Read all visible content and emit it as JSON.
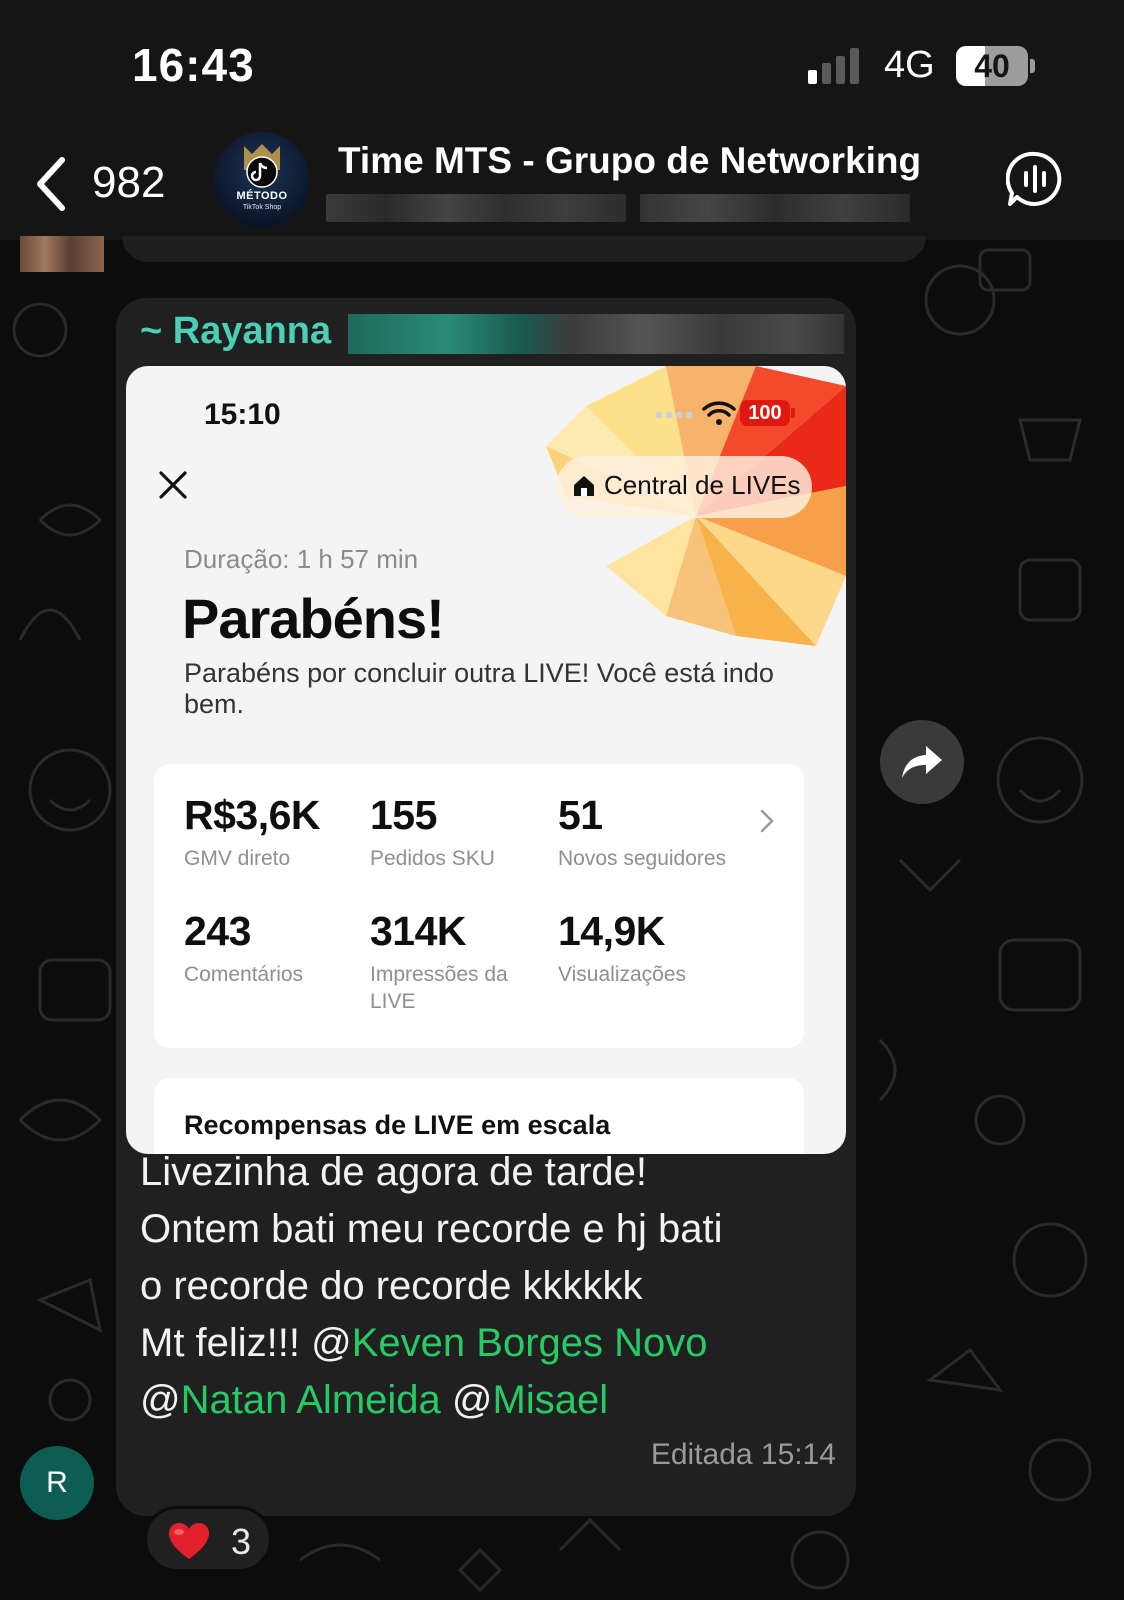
{
  "status_bar": {
    "time": "16:43",
    "network": "4G",
    "battery_level": 40,
    "battery_label": "40"
  },
  "chat_header": {
    "back_count": "982",
    "group_name": "Time MTS - Grupo de Networking",
    "avatar_text_line1": "MÉTODO",
    "avatar_text_line2": "TikTok Shop",
    "avatar_icon": "tiktok-logo-icon",
    "call_icon": "group-voice-call-icon"
  },
  "message": {
    "sender": "~ Rayanna",
    "image": {
      "phone_time": "15:10",
      "phone_battery": "100",
      "central_label": "Central de LIVEs",
      "duration": "Duração: 1 h 57 min",
      "title": "Parabéns!",
      "subtitle": "Parabéns por concluir outra LIVE! Você está indo bem.",
      "stats": [
        {
          "value": "R$3,6K",
          "label": "GMV direto"
        },
        {
          "value": "155",
          "label": "Pedidos SKU"
        },
        {
          "value": "51",
          "label": "Novos seguidores"
        },
        {
          "value": "243",
          "label": "Comentários"
        },
        {
          "value": "314K",
          "label": "Impressões da LIVE"
        },
        {
          "value": "14,9K",
          "label": "Visualizações"
        }
      ],
      "rewards_title": "Recompensas de LIVE em escala"
    },
    "text_line1": "Livezinha de agora de tarde!",
    "text_line2": "Ontem bati meu recorde e hj bati",
    "text_line3": "o recorde do recorde kkkkkk",
    "text_line4": "Mt feliz!!! ",
    "mentions": [
      "Keven Borges Novo",
      "Natan Almeida",
      "Misael"
    ],
    "edited_label": "Editada",
    "timestamp": "15:14",
    "avatar_initial": "R",
    "reaction": {
      "emoji": "heart",
      "count": "3"
    }
  },
  "colors": {
    "sender_name": "#4bd0b6",
    "mention": "#26cb66",
    "bubble": "#202020",
    "header": "#151515"
  }
}
